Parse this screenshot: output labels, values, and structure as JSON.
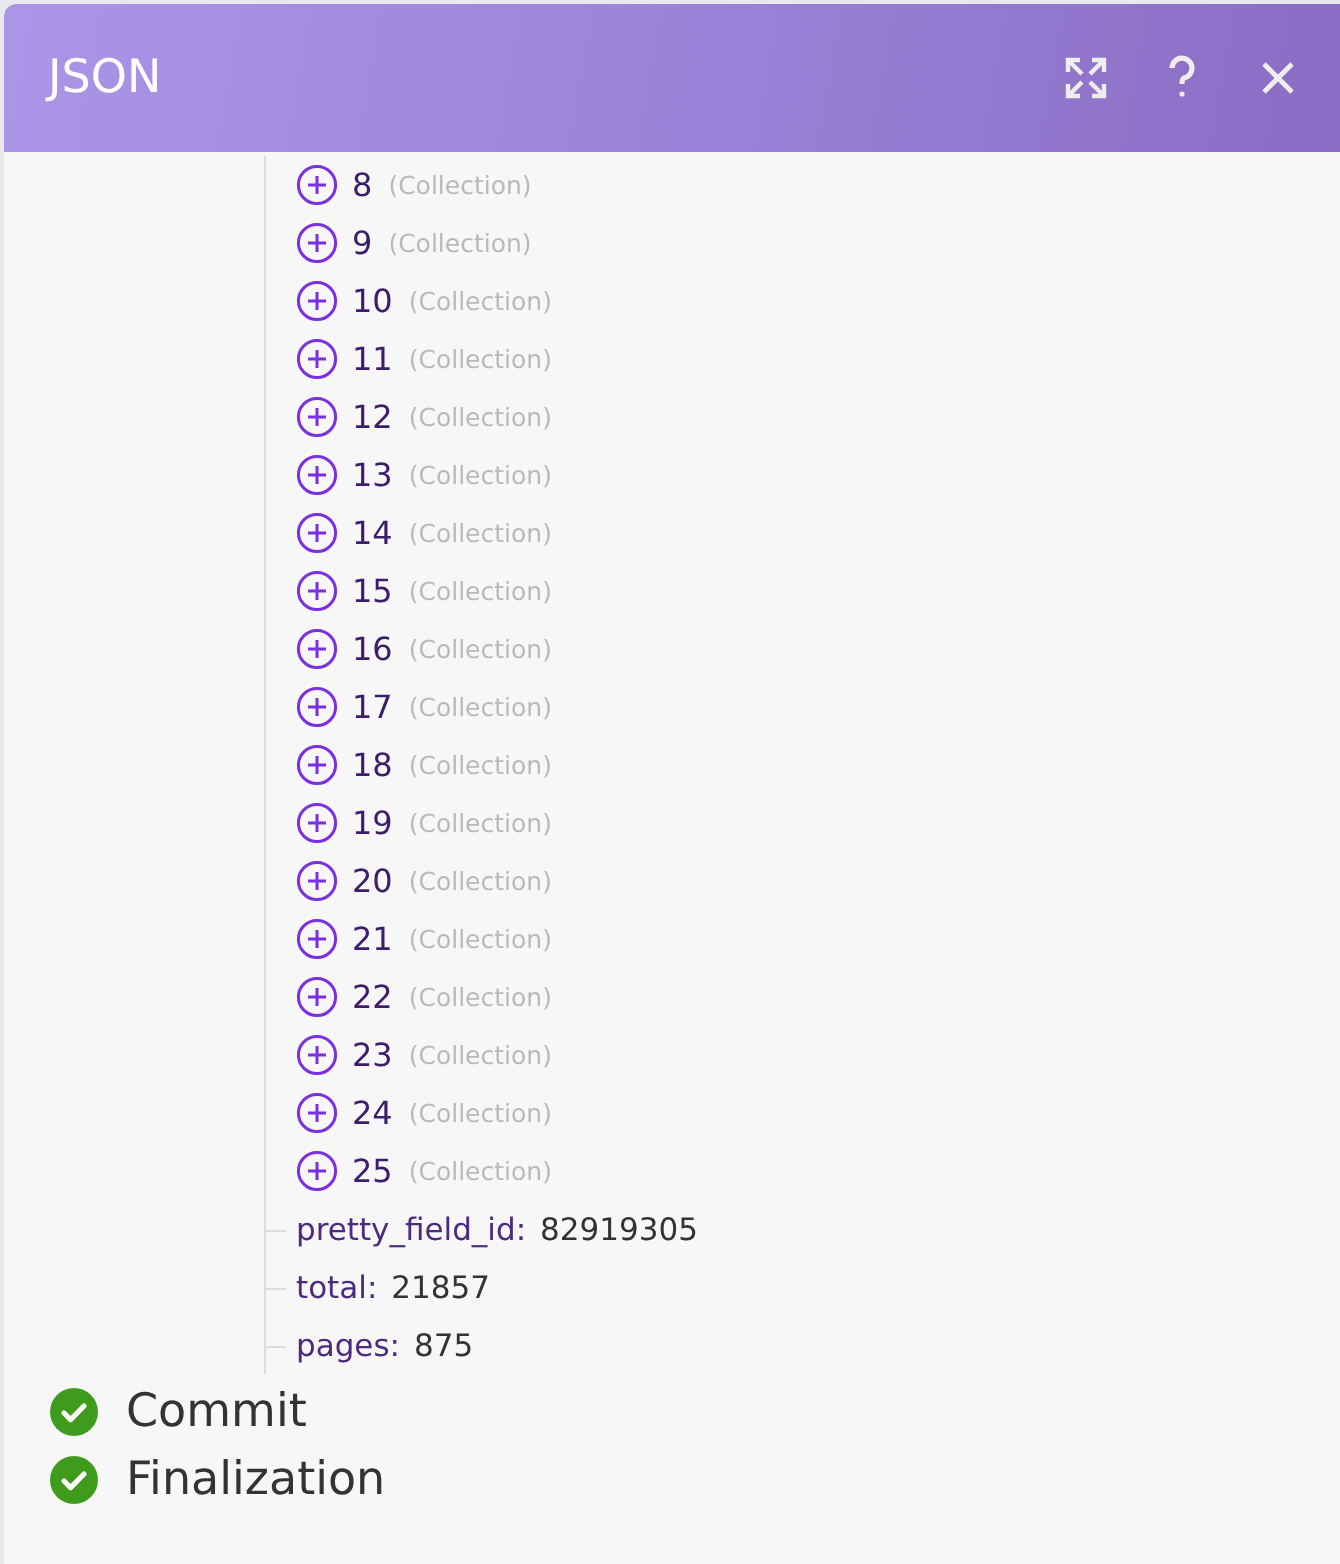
{
  "window": {
    "title": "JSON"
  },
  "tree": [
    {
      "kind": "collection",
      "key": "8",
      "type": "(Collection)",
      "expanded": false
    },
    {
      "kind": "collection",
      "key": "9",
      "type": "(Collection)",
      "expanded": false
    },
    {
      "kind": "collection",
      "key": "10",
      "type": "(Collection)",
      "expanded": false
    },
    {
      "kind": "collection",
      "key": "11",
      "type": "(Collection)",
      "expanded": false
    },
    {
      "kind": "collection",
      "key": "12",
      "type": "(Collection)",
      "expanded": false
    },
    {
      "kind": "collection",
      "key": "13",
      "type": "(Collection)",
      "expanded": false
    },
    {
      "kind": "collection",
      "key": "14",
      "type": "(Collection)",
      "expanded": false
    },
    {
      "kind": "collection",
      "key": "15",
      "type": "(Collection)",
      "expanded": false
    },
    {
      "kind": "collection",
      "key": "16",
      "type": "(Collection)",
      "expanded": false
    },
    {
      "kind": "collection",
      "key": "17",
      "type": "(Collection)",
      "expanded": false
    },
    {
      "kind": "collection",
      "key": "18",
      "type": "(Collection)",
      "expanded": false
    },
    {
      "kind": "collection",
      "key": "19",
      "type": "(Collection)",
      "expanded": false
    },
    {
      "kind": "collection",
      "key": "20",
      "type": "(Collection)",
      "expanded": false
    },
    {
      "kind": "collection",
      "key": "21",
      "type": "(Collection)",
      "expanded": false
    },
    {
      "kind": "collection",
      "key": "22",
      "type": "(Collection)",
      "expanded": false
    },
    {
      "kind": "collection",
      "key": "23",
      "type": "(Collection)",
      "expanded": false
    },
    {
      "kind": "collection",
      "key": "24",
      "type": "(Collection)",
      "expanded": false
    },
    {
      "kind": "collection",
      "key": "25",
      "type": "(Collection)",
      "expanded": false
    },
    {
      "kind": "field",
      "key": "pretty_field_id:",
      "value": "82919305"
    },
    {
      "kind": "field",
      "key": "total:",
      "value": "21857"
    },
    {
      "kind": "field",
      "key": "pages:",
      "value": "875"
    }
  ],
  "steps": [
    {
      "label": "Commit",
      "done": true
    },
    {
      "label": "Finalization",
      "done": true
    }
  ]
}
